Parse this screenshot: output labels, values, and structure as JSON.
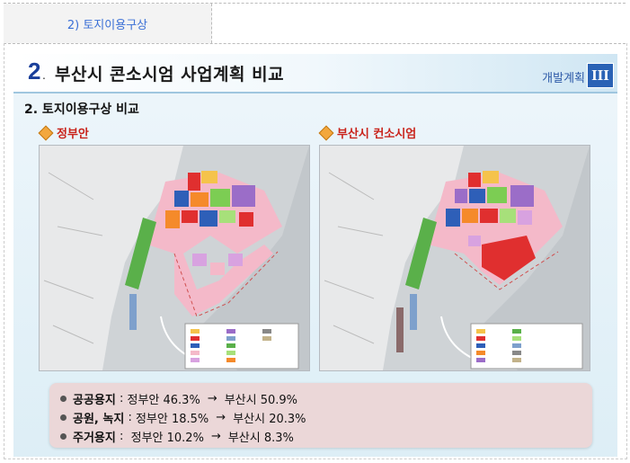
{
  "header": {
    "label": "2) 토지이용구상"
  },
  "slide": {
    "number": "2",
    "title": "부산시 콘소시엄 사업계획 비교",
    "tag": "개발계획",
    "roman": "III",
    "subtitle": "2. 토지이용구상 비교"
  },
  "maps": [
    {
      "label": "정부안"
    },
    {
      "label": "부산시 컨소시엄"
    }
  ],
  "summary": {
    "items": [
      {
        "key": "공공용지",
        "sep": " : ",
        "from": "정부안 46.3%",
        "arrow": "→",
        "to": "부산시 50.9%"
      },
      {
        "key": "공원, 녹지",
        "sep": " : ",
        "from": "정부안 18.5%",
        "arrow": "→",
        "to": "부산시 20.3%"
      },
      {
        "key": "주거용지",
        "sep": " :  ",
        "from": "정부안 10.2%",
        "arrow": "→",
        "to": "부산시 8.3%"
      }
    ]
  },
  "colors": {
    "title_blue": "#1a3f9a",
    "label_red": "#c9231b",
    "summary_bg": "#ebd7d8",
    "map_bg": "#d9dcdf"
  }
}
